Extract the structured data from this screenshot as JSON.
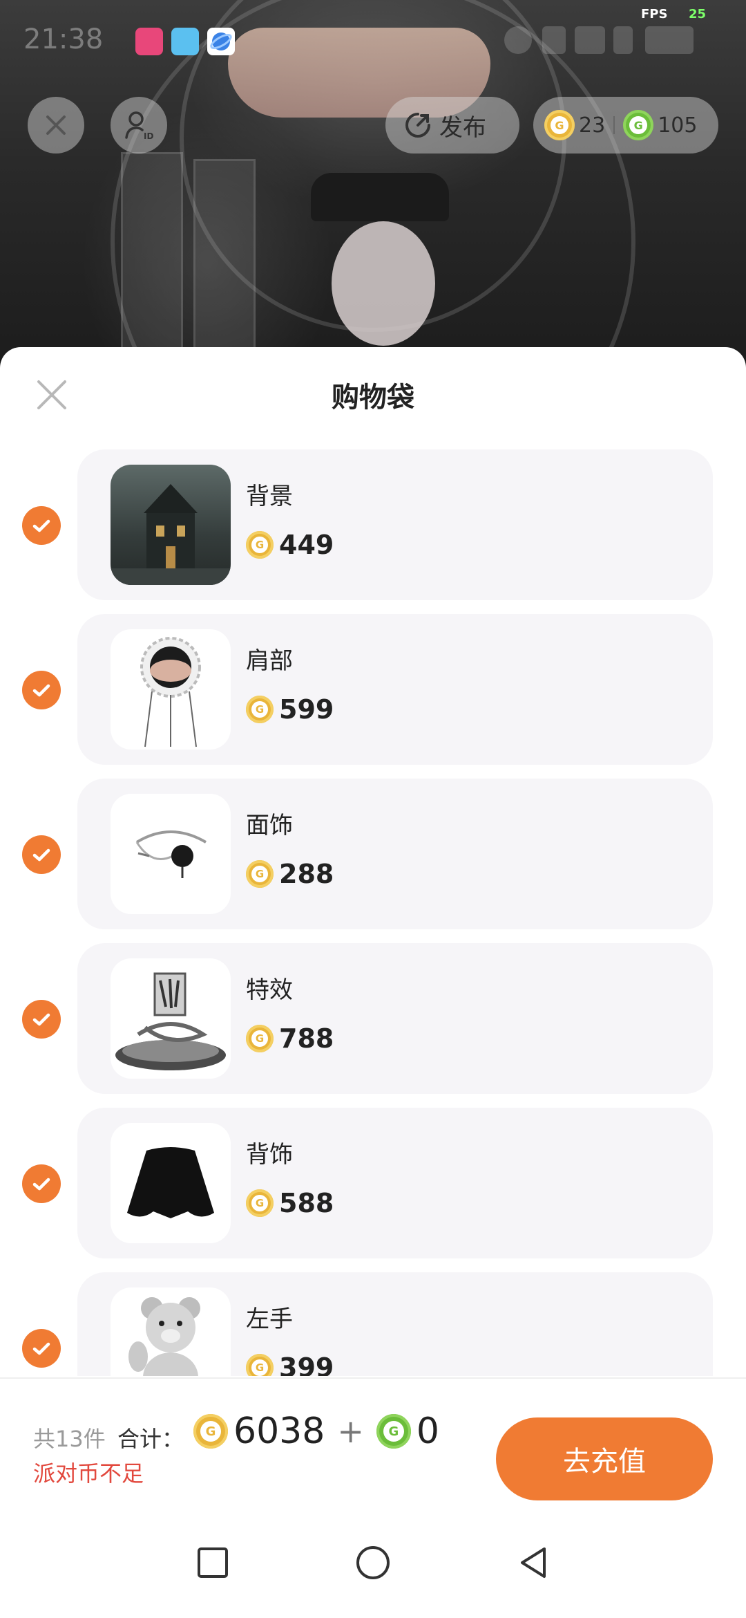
{
  "status_bar": {
    "time": "21:38",
    "fps_label": "FPS",
    "fps_value": "25",
    "app_icons": [
      "video-app-icon",
      "book-app-icon",
      "globe-app-icon"
    ]
  },
  "top_bar": {
    "publish_label": "发布",
    "gold_balance": "23",
    "green_balance": "105"
  },
  "sheet": {
    "title": "购物袋",
    "items": [
      {
        "name": "背景",
        "price": "449",
        "thumb": "haunted-house-thumbnail"
      },
      {
        "name": "肩部",
        "price": "599",
        "thumb": "shoulder-hand-thumbnail"
      },
      {
        "name": "面饰",
        "price": "288",
        "thumb": "face-chain-thumbnail"
      },
      {
        "name": "特效",
        "price": "788",
        "thumb": "effect-swirl-thumbnail"
      },
      {
        "name": "背饰",
        "price": "588",
        "thumb": "black-cape-thumbnail"
      },
      {
        "name": "左手",
        "price": "399",
        "thumb": "teddy-bear-thumbnail"
      }
    ]
  },
  "footer": {
    "count": "共13件",
    "total_label": "合计：",
    "gold_total": "6038",
    "plus": "+",
    "green_total": "0",
    "warning": "派对币不足",
    "recharge_label": "去充值"
  },
  "colors": {
    "accent": "#f07b33",
    "gold_coin": "#e9b53a",
    "green_coin": "#6bbd3a",
    "warning": "#e2483d"
  }
}
